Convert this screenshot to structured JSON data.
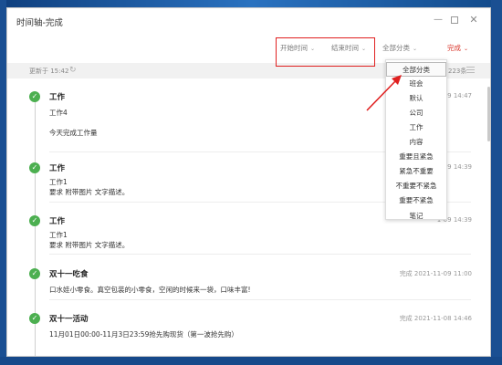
{
  "window": {
    "title": "时间轴-完成",
    "minimize_label": "—",
    "close_label": "✕"
  },
  "filters": {
    "start_time": "开始时间",
    "end_time": "结束时间",
    "category": "全部分类",
    "status": "完成",
    "chevron": "⌄"
  },
  "update_bar": {
    "text": "更新于 15:42",
    "refresh_glyph": "↻",
    "count": "223条"
  },
  "dropdown": {
    "items": [
      "全部分类",
      "班会",
      "默认",
      "公司",
      "工作",
      "内容",
      "重要且紧急",
      "紧急不重要",
      "不重要不紧急",
      "重要不紧急",
      "笔记"
    ],
    "selected_index": 0
  },
  "timeline": {
    "check_glyph": "✓",
    "entries": [
      {
        "title": "工作",
        "lines": [
          "工作4",
          "今天完成工作量"
        ],
        "time": "1-09 14:47"
      },
      {
        "title": "工作",
        "lines": [
          "工作1",
          "要求  附带图片 文字描述。"
        ],
        "time": "1-09 14:39"
      },
      {
        "title": "工作",
        "lines": [
          "工作1",
          "要求  附带图片 文字描述。"
        ],
        "time": "1-09 14:39"
      },
      {
        "title": "双十一吃食",
        "lines": [
          "口水娃小零食。真空包装的小零食，空闲的时候来一袋，口味丰富!"
        ],
        "time": "完成 2021-11-09 11:00"
      },
      {
        "title": "双十一活动",
        "lines": [
          "11月01日00:00-11月3日23:59抢先购现货（第一波抢先购）"
        ],
        "time": "完成 2021-11-08 14:46"
      }
    ]
  },
  "colors": {
    "accent_red": "#d9362b",
    "check_green": "#4caf50",
    "annotation_red": "#e02020"
  }
}
